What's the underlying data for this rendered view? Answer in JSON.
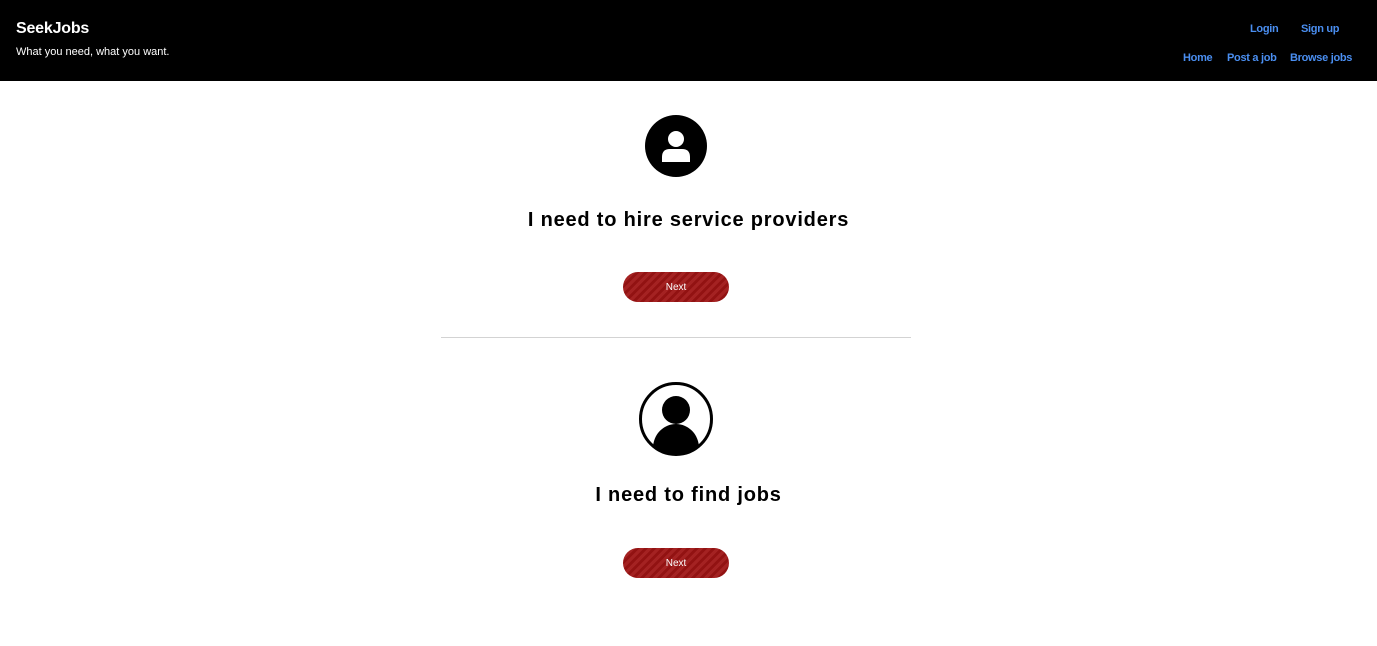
{
  "header": {
    "brand": "SeekJobs",
    "tagline": "What you need, what you want.",
    "auth_links": {
      "login": "Login",
      "signup": "Sign up"
    },
    "nav_links": {
      "home": "Home",
      "post_job": "Post a job",
      "browse_jobs": "Browse jobs"
    }
  },
  "options": [
    {
      "icon": "user-circle-icon",
      "heading": "I need to hire service providers",
      "button_label": "Next"
    },
    {
      "icon": "user-outline-icon",
      "heading": "I need to find jobs",
      "button_label": "Next"
    }
  ],
  "colors": {
    "header_bg": "#000000",
    "link": "#4a8ef0",
    "button_bg": "#9e1414",
    "divider": "#d3d3d3"
  }
}
